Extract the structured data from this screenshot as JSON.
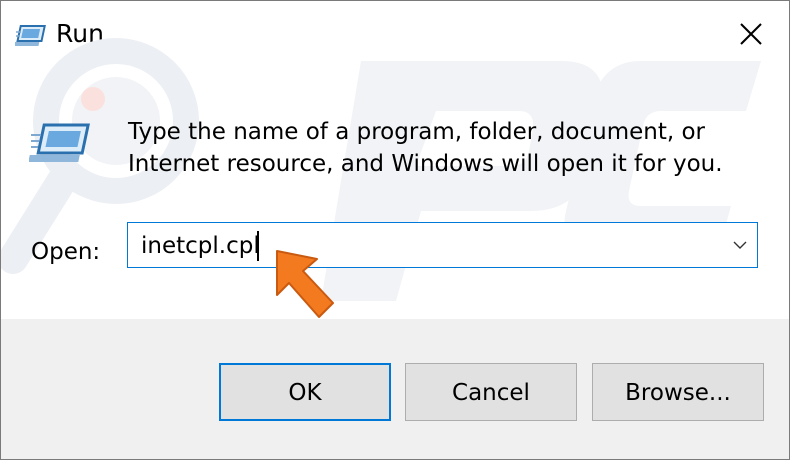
{
  "window": {
    "title": "Run",
    "icon": "run-icon",
    "close_icon": "close-icon"
  },
  "content": {
    "icon": "run-icon",
    "description_line1": "Type the name of a program, folder, document, or",
    "description_line2": "Internet resource, and Windows will open it for you."
  },
  "open_field": {
    "label": "Open:",
    "value": "inetcpl.cpl",
    "dropdown_icon": "chevron-down-icon"
  },
  "buttons": {
    "ok": "OK",
    "cancel": "Cancel",
    "browse": "Browse..."
  },
  "colors": {
    "accent": "#0078d7",
    "button_bar": "#f0f0f0",
    "button_face": "#e1e1e1",
    "annotation_arrow": "#f47a20"
  }
}
